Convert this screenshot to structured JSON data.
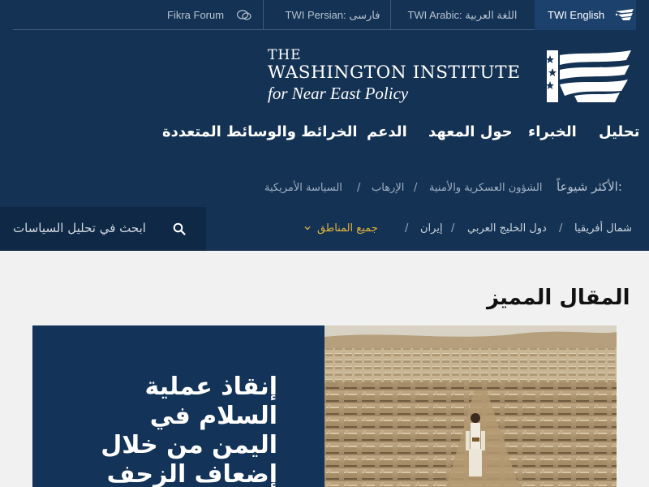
{
  "langbar": {
    "english": "TWI English",
    "arabic": "TWI Arabic: اللغة العربية",
    "persian": "TWI Persian: فارسی",
    "fikra": "Fikra Forum"
  },
  "logo": {
    "line1": "THE",
    "line2": "WASHINGTON INSTITUTE",
    "line3": "for Near East Policy"
  },
  "nav": {
    "analysis": "تحليل",
    "experts": "الخبراء",
    "about": "حول المعهد",
    "support": "الدعم",
    "maps": "الخرائط والوسائط المتعددة"
  },
  "popular": {
    "label": "الأكثر شيوعاً:",
    "items": [
      "الشؤون العسكرية والأمنية",
      "الإرهاب",
      "السياسة الأمريكية"
    ]
  },
  "search": {
    "placeholder": "ابحث في تحليل السياسات"
  },
  "regions": {
    "items": [
      "شمال أفريقيا",
      "دول الخليج العربي",
      "إيران"
    ],
    "all": "جميع المناطق"
  },
  "featured": {
    "section_title": "المقال المميز",
    "headline": "إنقاذ عملية السلام في اليمن من خلال إضعاف الزحف"
  },
  "colors": {
    "header_bg": "#143253",
    "search_bg": "#0f2845",
    "accent_gold": "#e2b33f",
    "card_bg": "#133458"
  }
}
